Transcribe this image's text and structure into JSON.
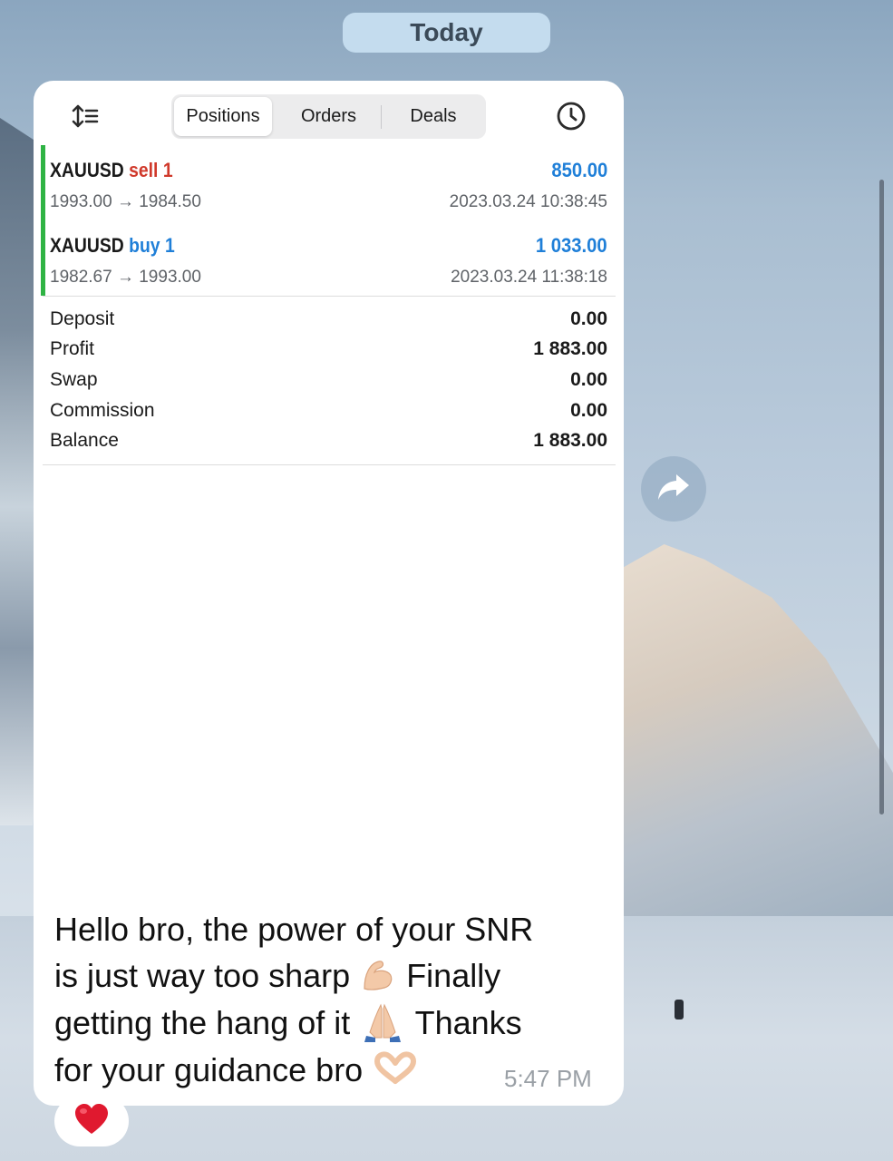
{
  "date_pill": {
    "label": "Today"
  },
  "segmented": {
    "tabs": [
      "Positions",
      "Orders",
      "Deals"
    ],
    "active": "Positions"
  },
  "deals": [
    {
      "symbol": "XAUUSD",
      "side": "sell 1",
      "prices": "1993.00 → 1984.50",
      "profit": "850.00",
      "time": "2023.03.24 10:38:45"
    },
    {
      "symbol": "XAUUSD",
      "side": "buy 1",
      "prices": "1982.67 → 1993.00",
      "profit": "1 033.00",
      "time": "2023.03.24 11:38:18"
    }
  ],
  "summary": [
    {
      "label": "Deposit",
      "value": "0.00"
    },
    {
      "label": "Profit",
      "value": "1 883.00"
    },
    {
      "label": "Swap",
      "value": "0.00"
    },
    {
      "label": "Commission",
      "value": "0.00"
    },
    {
      "label": "Balance",
      "value": "1 883.00"
    }
  ],
  "message": {
    "lines": [
      "Hello bro, the power of your SNR",
      "is just way too sharp",
      "Finally",
      "getting the hang of it",
      "Thanks",
      "for your guidance bro"
    ],
    "time": "5:47 PM"
  },
  "icons": {
    "sort": "sort-icon",
    "history": "clock-icon",
    "share": "share-icon",
    "reaction": "heart-icon",
    "muscle": "flexed-biceps-emoji",
    "pray": "folded-hands-emoji",
    "heart_hands": "heart-hands-emoji"
  },
  "colors": {
    "sell": "#d0392b",
    "buy": "#1f7fd8",
    "profit": "#1f7fd8",
    "accent": "#2fb344",
    "heart": "#e0192f"
  }
}
